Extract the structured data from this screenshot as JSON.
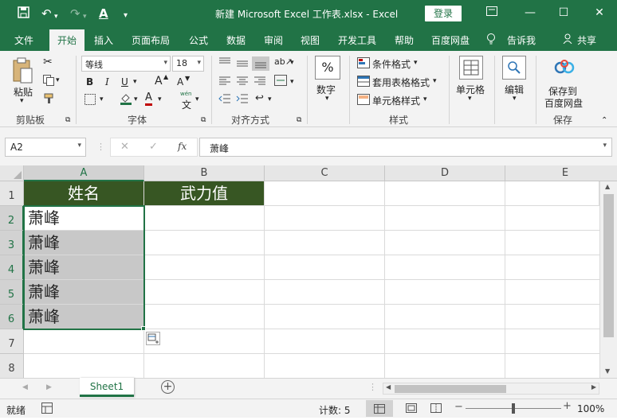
{
  "window": {
    "title": "新建 Microsoft Excel 工作表.xlsx  -  Excel",
    "login_label": "登录",
    "quick_access": {
      "save": "save-icon",
      "undo": "undo-icon",
      "redo": "redo-icon",
      "font_color": "A"
    }
  },
  "ribbon_tabs": [
    "文件",
    "开始",
    "插入",
    "页面布局",
    "公式",
    "数据",
    "审阅",
    "视图",
    "开发工具",
    "帮助",
    "百度网盘"
  ],
  "tell_me": "告诉我",
  "share": "共享",
  "ribbon": {
    "clipboard": {
      "paste": "粘贴",
      "label": "剪贴板"
    },
    "font": {
      "name": "等线",
      "size": "18",
      "label": "字体",
      "bold": "B",
      "italic": "I",
      "underline": "U",
      "grow": "A",
      "shrink": "A",
      "wen": "wén",
      "wen_char": "文"
    },
    "alignment": {
      "label": "对齐方式"
    },
    "number": {
      "button": "数字",
      "percent": "%"
    },
    "styles": {
      "conditional": "条件格式",
      "table": "套用表格格式",
      "cell_style": "单元格样式",
      "label": "样式"
    },
    "cells": {
      "button": "单元格"
    },
    "editing": {
      "button": "编辑"
    },
    "save": {
      "line1": "保存到",
      "line2": "百度网盘",
      "label": "保存"
    }
  },
  "formula_bar": {
    "name_box": "A2",
    "fx": "fx",
    "content": "萧峰"
  },
  "columns": [
    "A",
    "B",
    "C",
    "D",
    "E"
  ],
  "rows": [
    "1",
    "2",
    "3",
    "4",
    "5",
    "6",
    "7",
    "8"
  ],
  "cells": {
    "A1": "姓名",
    "B1": "武力值",
    "A2": "萧峰",
    "A3": "萧峰",
    "A4": "萧峰",
    "A5": "萧峰",
    "A6": "萧峰"
  },
  "sheet_tabs": [
    "Sheet1"
  ],
  "status": {
    "ready": "就绪",
    "count": "计数: 5",
    "zoom": "100%"
  },
  "colors": {
    "accent": "#217346",
    "header_fill": "#375623",
    "selection_fill": "#c8c8c8"
  }
}
